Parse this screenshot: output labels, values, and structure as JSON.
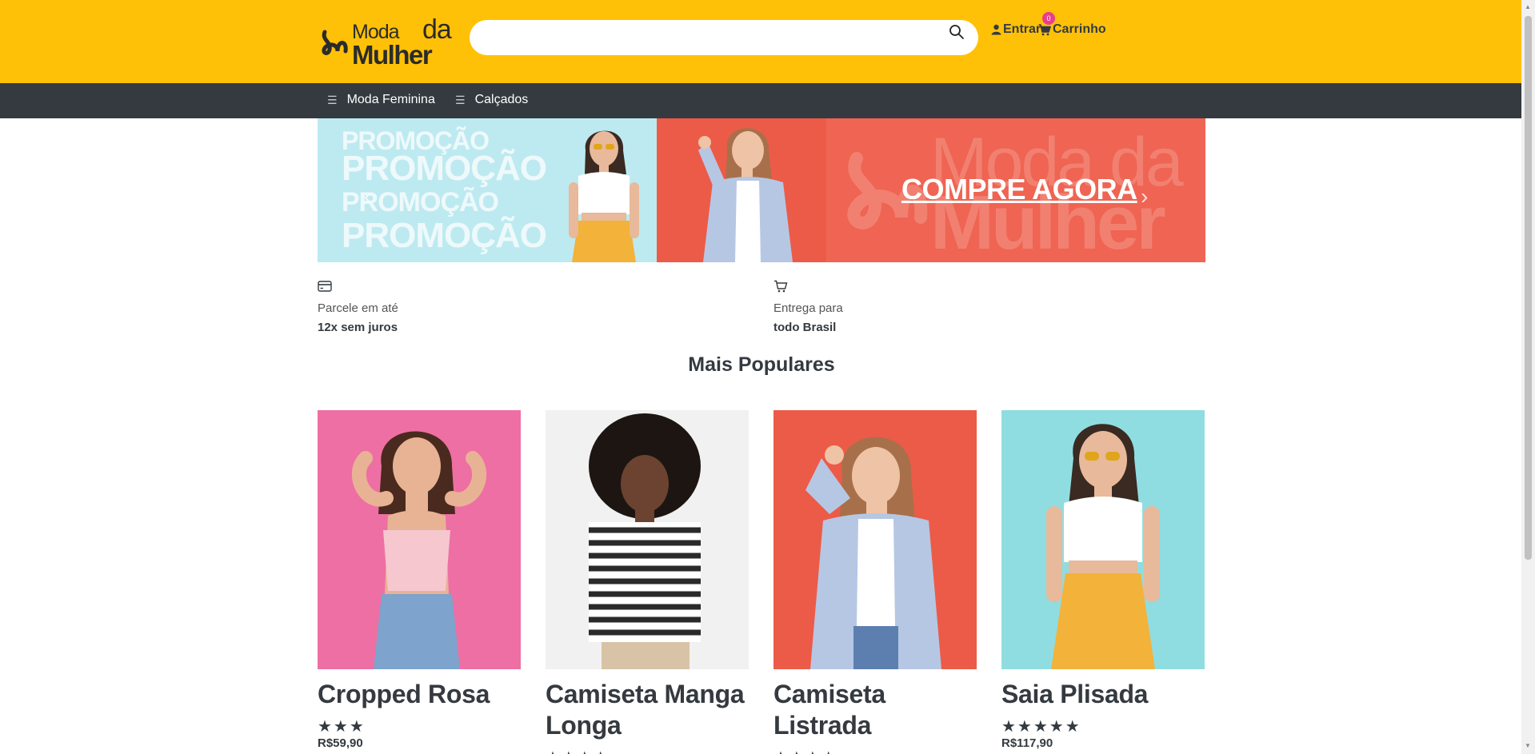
{
  "header": {
    "logo_top": "Moda",
    "logo_da": "da",
    "logo_bottom": "Mulher",
    "search": {
      "value": "",
      "placeholder": ""
    },
    "login_label": "Entrar",
    "cart_label": "Carrinho",
    "cart_count": "0",
    "bg_color": "#ffc107"
  },
  "nav": {
    "items": [
      {
        "label": "Moda Feminina",
        "icon": "menu-icon"
      },
      {
        "label": "Calçados",
        "icon": "menu-icon"
      }
    ]
  },
  "banner": {
    "promo_lines": [
      "PROMOÇÃO",
      "PROMOÇÃO",
      "PROMOÇÃO",
      "PROMOÇÃO"
    ],
    "watermark_top": "Moda da",
    "watermark_bottom": "Mulher",
    "cta": "COMPRE AGORA",
    "next_glyph": "›",
    "prev_glyph": "‹"
  },
  "info": [
    {
      "icon": "credit-card-icon",
      "line1": "Parcele em até",
      "line2": "12x sem juros"
    },
    {
      "icon": "cart-icon",
      "line1": "Entrega para",
      "line2": "todo Brasil"
    }
  ],
  "section_title": "Mais Populares",
  "products": [
    {
      "name": "Cropped Rosa",
      "stars": "★★★",
      "price": "R$59,90",
      "bg": "#ee6fa3"
    },
    {
      "name": "Camiseta Manga Longa",
      "stars": "★★★★",
      "price": "",
      "bg": "#f1f1f1"
    },
    {
      "name": "Camiseta Listrada",
      "stars": "★★★★",
      "price": "",
      "bg": "#ec5b47"
    },
    {
      "name": "Saia Plisada",
      "stars": "★★★★★",
      "price": "R$117,90",
      "bg": "#8fdde0"
    }
  ]
}
